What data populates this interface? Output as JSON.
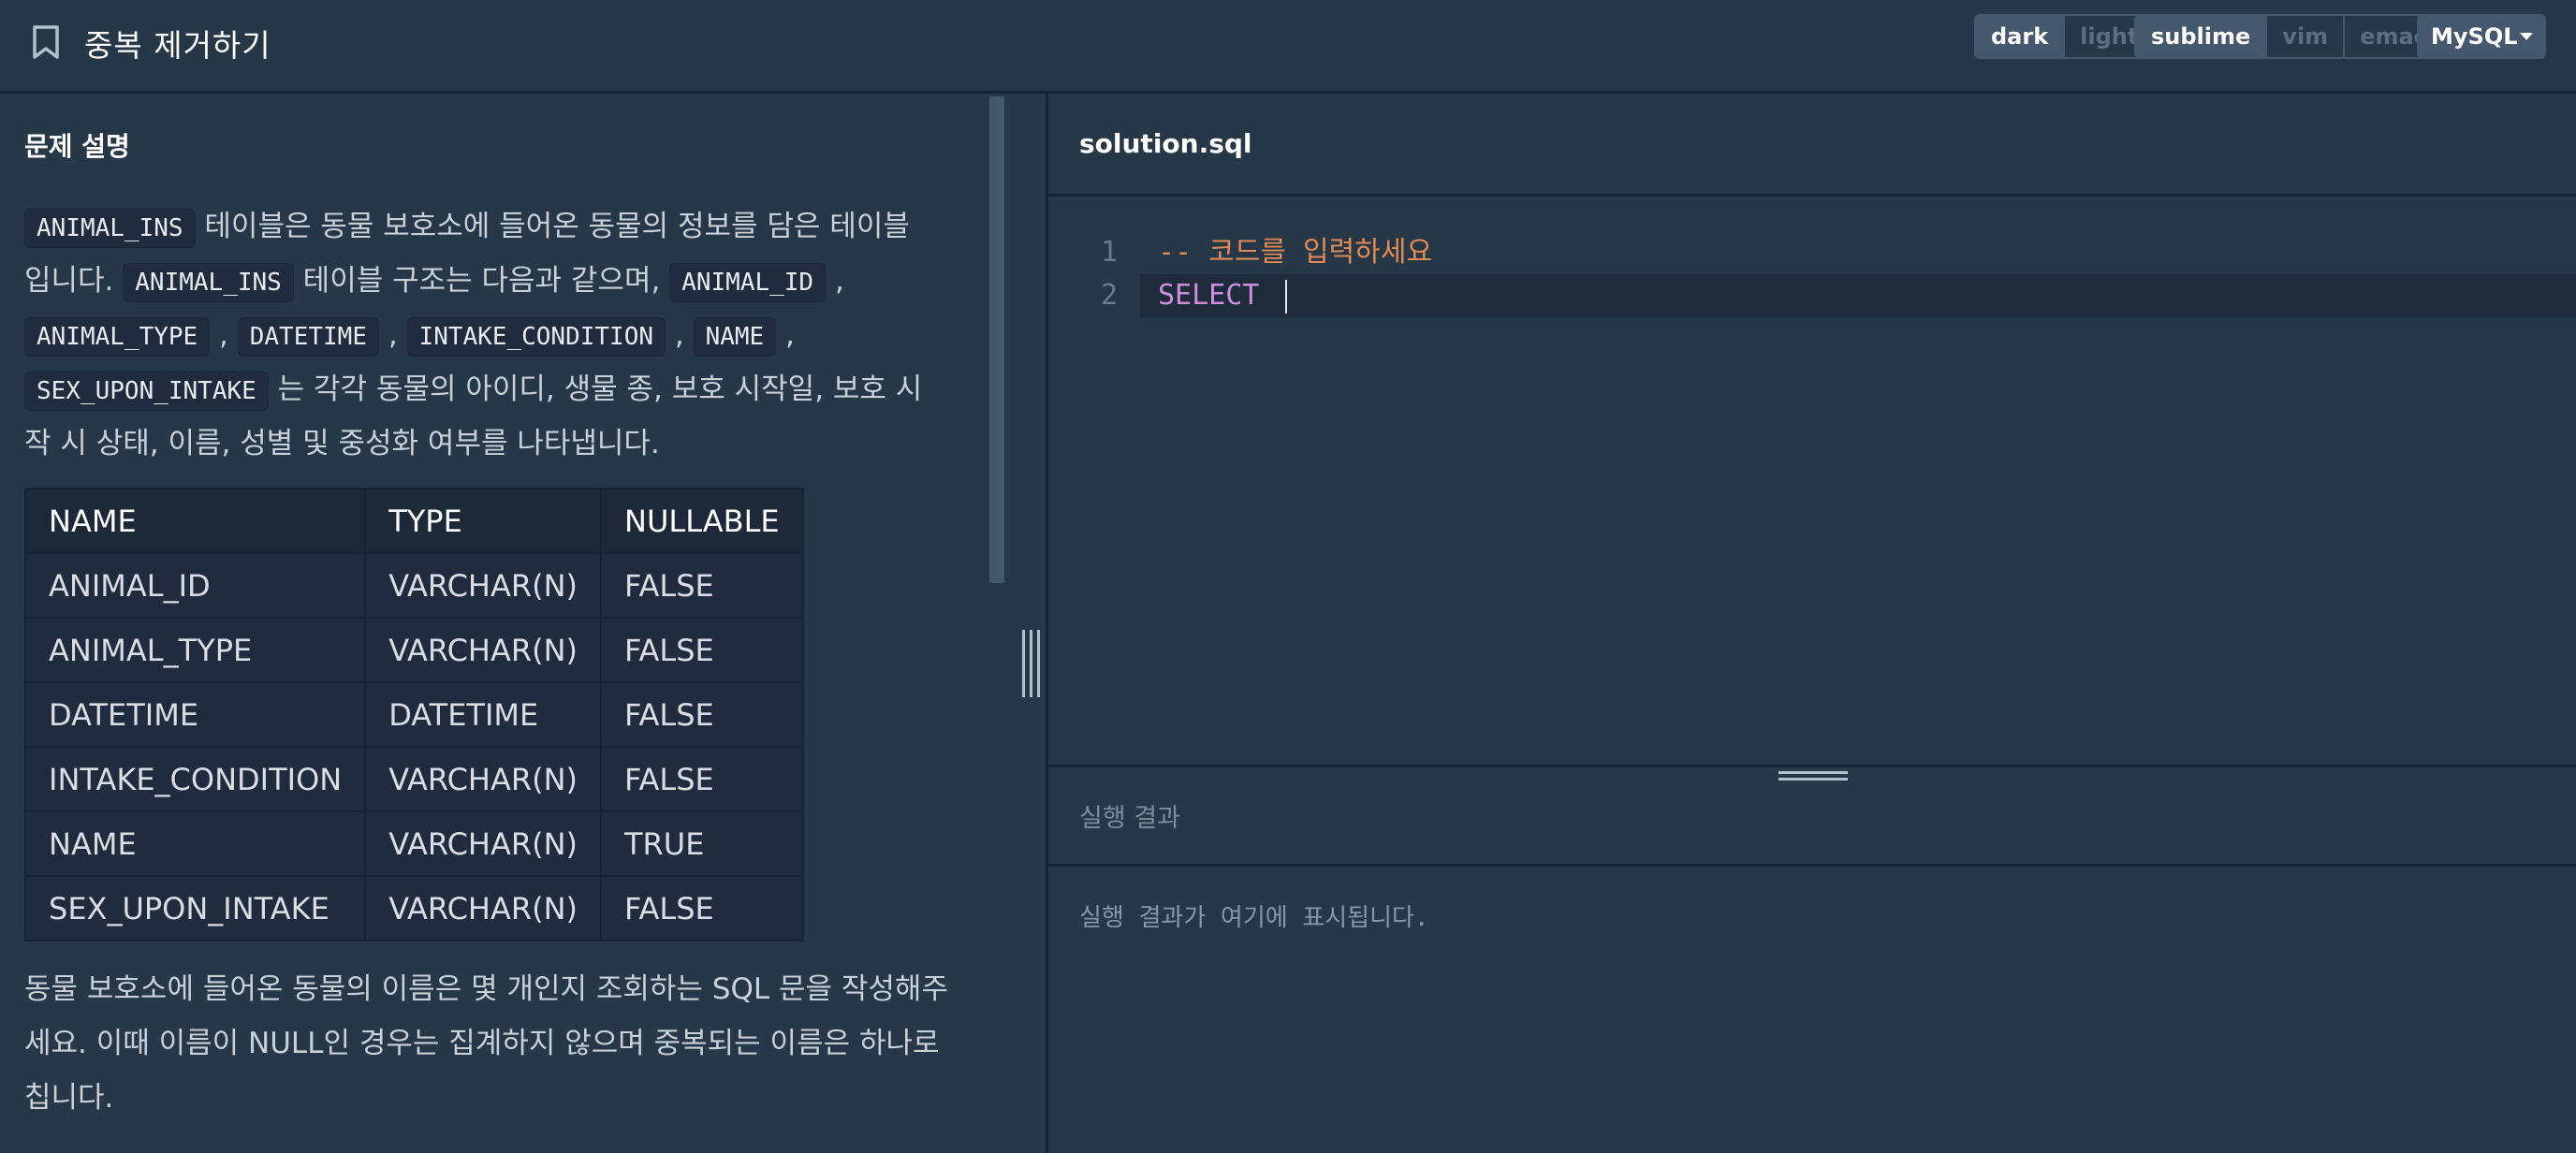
{
  "header": {
    "title": "중복 제거하기",
    "theme_options": [
      "dark",
      "light"
    ],
    "keymap_options": [
      "sublime",
      "vim",
      "emacs"
    ],
    "language": "MySQL"
  },
  "problem": {
    "section_title": "문제 설명",
    "intro": {
      "t1": "ANIMAL_INS",
      "t2": " 테이블은 동물 보호소에 들어온 동물의 정보를 담은 테이블",
      "t3": "입니다. ",
      "t4": "ANIMAL_INS",
      "t5": " 테이블 구조는 다음과 같으며, ",
      "t6": "ANIMAL_ID",
      "t7": " ,",
      "t8": "ANIMAL_TYPE",
      "t9": " , ",
      "t10": "DATETIME",
      "t11": " , ",
      "t12": "INTAKE_CONDITION",
      "t13": " , ",
      "t14": "NAME",
      "t15": " ,",
      "t16": "SEX_UPON_INTAKE",
      "t17": " 는 각각 동물의 아이디, 생물 종, 보호 시작일, 보호 시",
      "t18": "작 시 상태, 이름, 성별 및 중성화 여부를 나타냅니다."
    },
    "table": {
      "headers": [
        "NAME",
        "TYPE",
        "NULLABLE"
      ],
      "rows": [
        [
          "ANIMAL_ID",
          "VARCHAR(N)",
          "FALSE"
        ],
        [
          "ANIMAL_TYPE",
          "VARCHAR(N)",
          "FALSE"
        ],
        [
          "DATETIME",
          "DATETIME",
          "FALSE"
        ],
        [
          "INTAKE_CONDITION",
          "VARCHAR(N)",
          "FALSE"
        ],
        [
          "NAME",
          "VARCHAR(N)",
          "TRUE"
        ],
        [
          "SEX_UPON_INTAKE",
          "VARCHAR(N)",
          "FALSE"
        ]
      ]
    },
    "question_lines": [
      "동물 보호소에 들어온 동물의 이름은 몇 개인지 조회하는 SQL 문을 작성해주",
      "세요. 이때 이름이 NULL인 경우는 집계하지 않으며 중복되는 이름은 하나로",
      "칩니다."
    ]
  },
  "editor": {
    "filename": "solution.sql",
    "lines": [
      {
        "num": "1",
        "text": "-- 코드를 입력하세요"
      },
      {
        "num": "2",
        "text": "SELECT "
      }
    ]
  },
  "result": {
    "title": "실행 결과",
    "placeholder": "실행 결과가 여기에 표시됩니다."
  },
  "colors": {
    "background": "#263747",
    "divider": "#172334",
    "comment": "#e08a55",
    "keyword": "#cc8fe0",
    "active_button": "#44576c"
  }
}
